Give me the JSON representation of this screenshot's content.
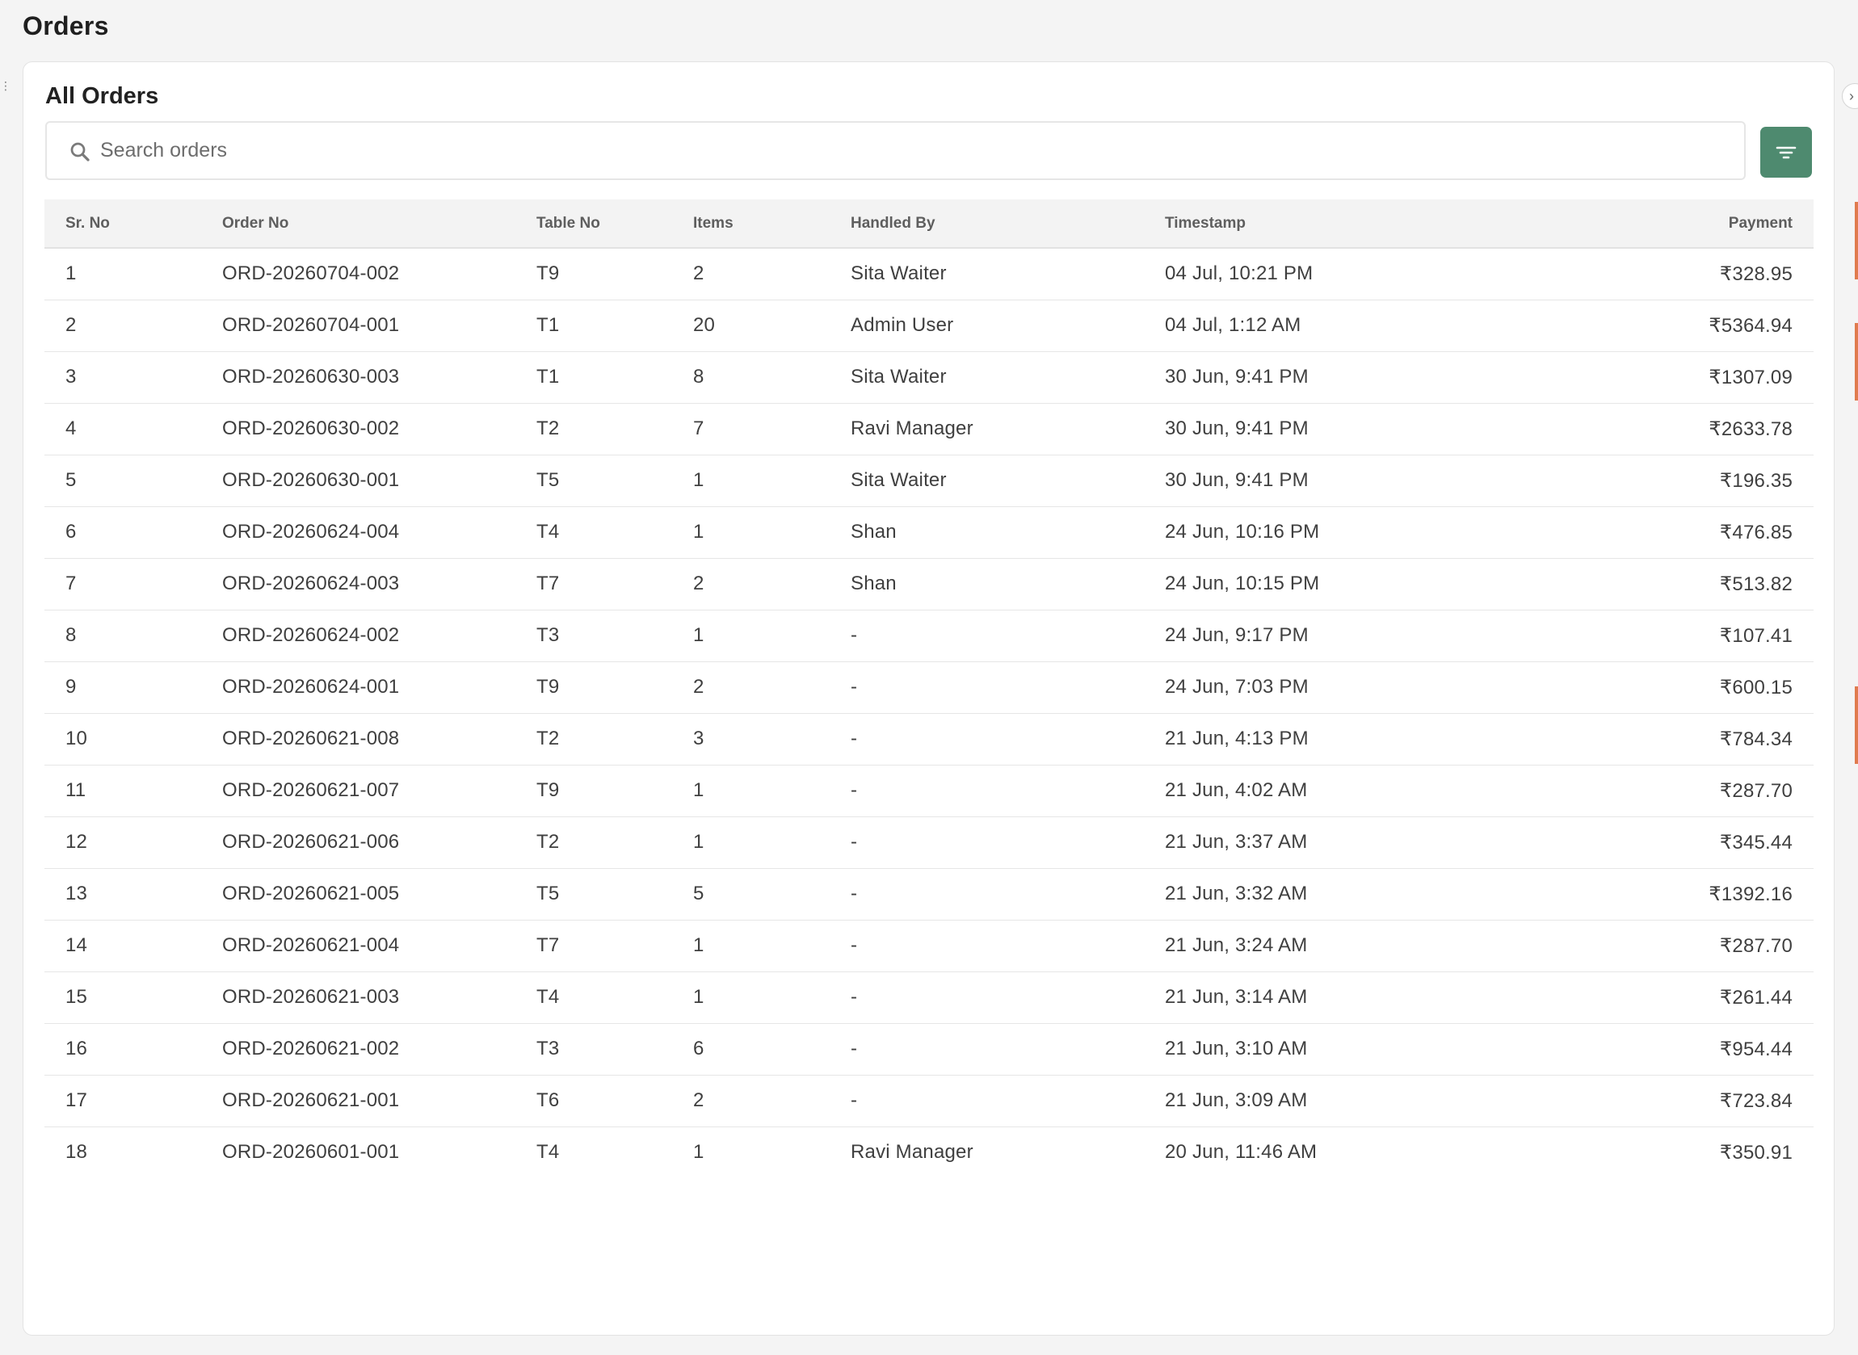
{
  "page": {
    "title": "Orders"
  },
  "card": {
    "title": "All Orders"
  },
  "search": {
    "placeholder": "Search orders",
    "value": ""
  },
  "filter": {
    "icon": "filter-icon"
  },
  "colors": {
    "accent": "#4e8a6f",
    "background": "#f4f4f4",
    "card": "#ffffff",
    "header_row": "#f3f3f3"
  },
  "table": {
    "columns": [
      "Sr. No",
      "Order No",
      "Table No",
      "Items",
      "Handled By",
      "Timestamp",
      "Payment"
    ],
    "rows": [
      {
        "sr": "1",
        "order": "ORD-20260704-002",
        "table": "T9",
        "items": "2",
        "handled": "Sita Waiter",
        "time": "04 Jul, 10:21 PM",
        "payment": "₹328.95"
      },
      {
        "sr": "2",
        "order": "ORD-20260704-001",
        "table": "T1",
        "items": "20",
        "handled": "Admin User",
        "time": "04 Jul, 1:12 AM",
        "payment": "₹5364.94"
      },
      {
        "sr": "3",
        "order": "ORD-20260630-003",
        "table": "T1",
        "items": "8",
        "handled": "Sita Waiter",
        "time": "30 Jun, 9:41 PM",
        "payment": "₹1307.09"
      },
      {
        "sr": "4",
        "order": "ORD-20260630-002",
        "table": "T2",
        "items": "7",
        "handled": "Ravi Manager",
        "time": "30 Jun, 9:41 PM",
        "payment": "₹2633.78"
      },
      {
        "sr": "5",
        "order": "ORD-20260630-001",
        "table": "T5",
        "items": "1",
        "handled": "Sita Waiter",
        "time": "30 Jun, 9:41 PM",
        "payment": "₹196.35"
      },
      {
        "sr": "6",
        "order": "ORD-20260624-004",
        "table": "T4",
        "items": "1",
        "handled": "Shan",
        "time": "24 Jun, 10:16 PM",
        "payment": "₹476.85"
      },
      {
        "sr": "7",
        "order": "ORD-20260624-003",
        "table": "T7",
        "items": "2",
        "handled": "Shan",
        "time": "24 Jun, 10:15 PM",
        "payment": "₹513.82"
      },
      {
        "sr": "8",
        "order": "ORD-20260624-002",
        "table": "T3",
        "items": "1",
        "handled": "-",
        "time": "24 Jun, 9:17 PM",
        "payment": "₹107.41"
      },
      {
        "sr": "9",
        "order": "ORD-20260624-001",
        "table": "T9",
        "items": "2",
        "handled": "-",
        "time": "24 Jun, 7:03 PM",
        "payment": "₹600.15"
      },
      {
        "sr": "10",
        "order": "ORD-20260621-008",
        "table": "T2",
        "items": "3",
        "handled": "-",
        "time": "21 Jun, 4:13 PM",
        "payment": "₹784.34"
      },
      {
        "sr": "11",
        "order": "ORD-20260621-007",
        "table": "T9",
        "items": "1",
        "handled": "-",
        "time": "21 Jun, 4:02 AM",
        "payment": "₹287.70"
      },
      {
        "sr": "12",
        "order": "ORD-20260621-006",
        "table": "T2",
        "items": "1",
        "handled": "-",
        "time": "21 Jun, 3:37 AM",
        "payment": "₹345.44"
      },
      {
        "sr": "13",
        "order": "ORD-20260621-005",
        "table": "T5",
        "items": "5",
        "handled": "-",
        "time": "21 Jun, 3:32 AM",
        "payment": "₹1392.16"
      },
      {
        "sr": "14",
        "order": "ORD-20260621-004",
        "table": "T7",
        "items": "1",
        "handled": "-",
        "time": "21 Jun, 3:24 AM",
        "payment": "₹287.70"
      },
      {
        "sr": "15",
        "order": "ORD-20260621-003",
        "table": "T4",
        "items": "1",
        "handled": "-",
        "time": "21 Jun, 3:14 AM",
        "payment": "₹261.44"
      },
      {
        "sr": "16",
        "order": "ORD-20260621-002",
        "table": "T3",
        "items": "6",
        "handled": "-",
        "time": "21 Jun, 3:10 AM",
        "payment": "₹954.44"
      },
      {
        "sr": "17",
        "order": "ORD-20260621-001",
        "table": "T6",
        "items": "2",
        "handled": "-",
        "time": "21 Jun, 3:09 AM",
        "payment": "₹723.84"
      },
      {
        "sr": "18",
        "order": "ORD-20260601-001",
        "table": "T4",
        "items": "1",
        "handled": "Ravi Manager",
        "time": "20 Jun, 11:46 AM",
        "payment": "₹350.91"
      }
    ]
  }
}
